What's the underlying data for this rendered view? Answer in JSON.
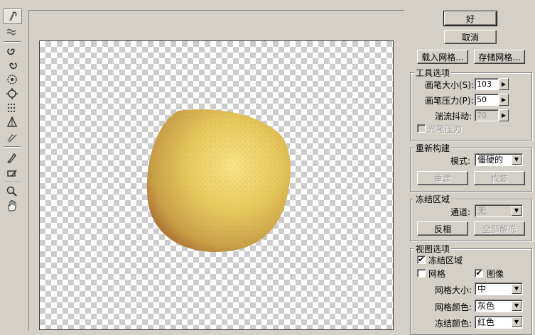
{
  "toolbar": {
    "tools": [
      {
        "icon": "forward-warp-icon",
        "active": true
      },
      {
        "icon": "reconstruct-icon",
        "active": false
      },
      {
        "icon": "twirl-clockwise-icon",
        "active": false
      },
      {
        "icon": "twirl-counterclockwise-icon",
        "active": false
      },
      {
        "icon": "pucker-icon",
        "active": false
      },
      {
        "icon": "bloat-icon",
        "active": false
      },
      {
        "icon": "push-left-icon",
        "active": false
      },
      {
        "icon": "mirror-icon",
        "active": false
      },
      {
        "icon": "turbulence-icon",
        "active": false
      },
      {
        "icon": "freeze-mask-icon",
        "active": false
      },
      {
        "icon": "thaw-mask-icon",
        "active": false
      },
      {
        "icon": "zoom-icon",
        "active": false
      },
      {
        "icon": "hand-icon",
        "active": false
      }
    ]
  },
  "buttons": {
    "ok": "好",
    "cancel": "取消",
    "load_mesh": "载入网格...",
    "save_mesh": "存储网格..."
  },
  "tool_options": {
    "title": "工具选项",
    "brush_size_label": "画笔大小(S):",
    "brush_size_value": "103",
    "brush_pressure_label": "画笔压力(P):",
    "brush_pressure_value": "50",
    "turbulent_jitter_label": "湍流抖动:",
    "turbulent_jitter_value": "70",
    "stylus_pressure_label": "光笔压力"
  },
  "reconstruct": {
    "title": "重新构建",
    "mode_label": "模式:",
    "mode_value": "僵硬的",
    "reconstruct_button": "重建",
    "restore_button": "恢复"
  },
  "freeze_area": {
    "title": "冻结区域",
    "channel_label": "通道:",
    "channel_value": "无",
    "invert_button": "反相",
    "thaw_all_button": "全部解冻"
  },
  "view_options": {
    "title": "视图选项",
    "show_frozen_label": "冻结区域",
    "show_frozen_checked": "✔",
    "show_mesh_label": "网格",
    "show_image_label": "图像",
    "show_image_checked": "✔",
    "mesh_size_label": "网格大小:",
    "mesh_size_value": "中",
    "mesh_color_label": "网格颜色:",
    "mesh_color_value": "灰色",
    "freeze_color_label": "冻结颜色:",
    "freeze_color_value": "红色"
  },
  "colors": {
    "dialog_bg": "#d4d0c8",
    "pear_light": "#f3df70",
    "pear_dark": "#b77a3a"
  }
}
